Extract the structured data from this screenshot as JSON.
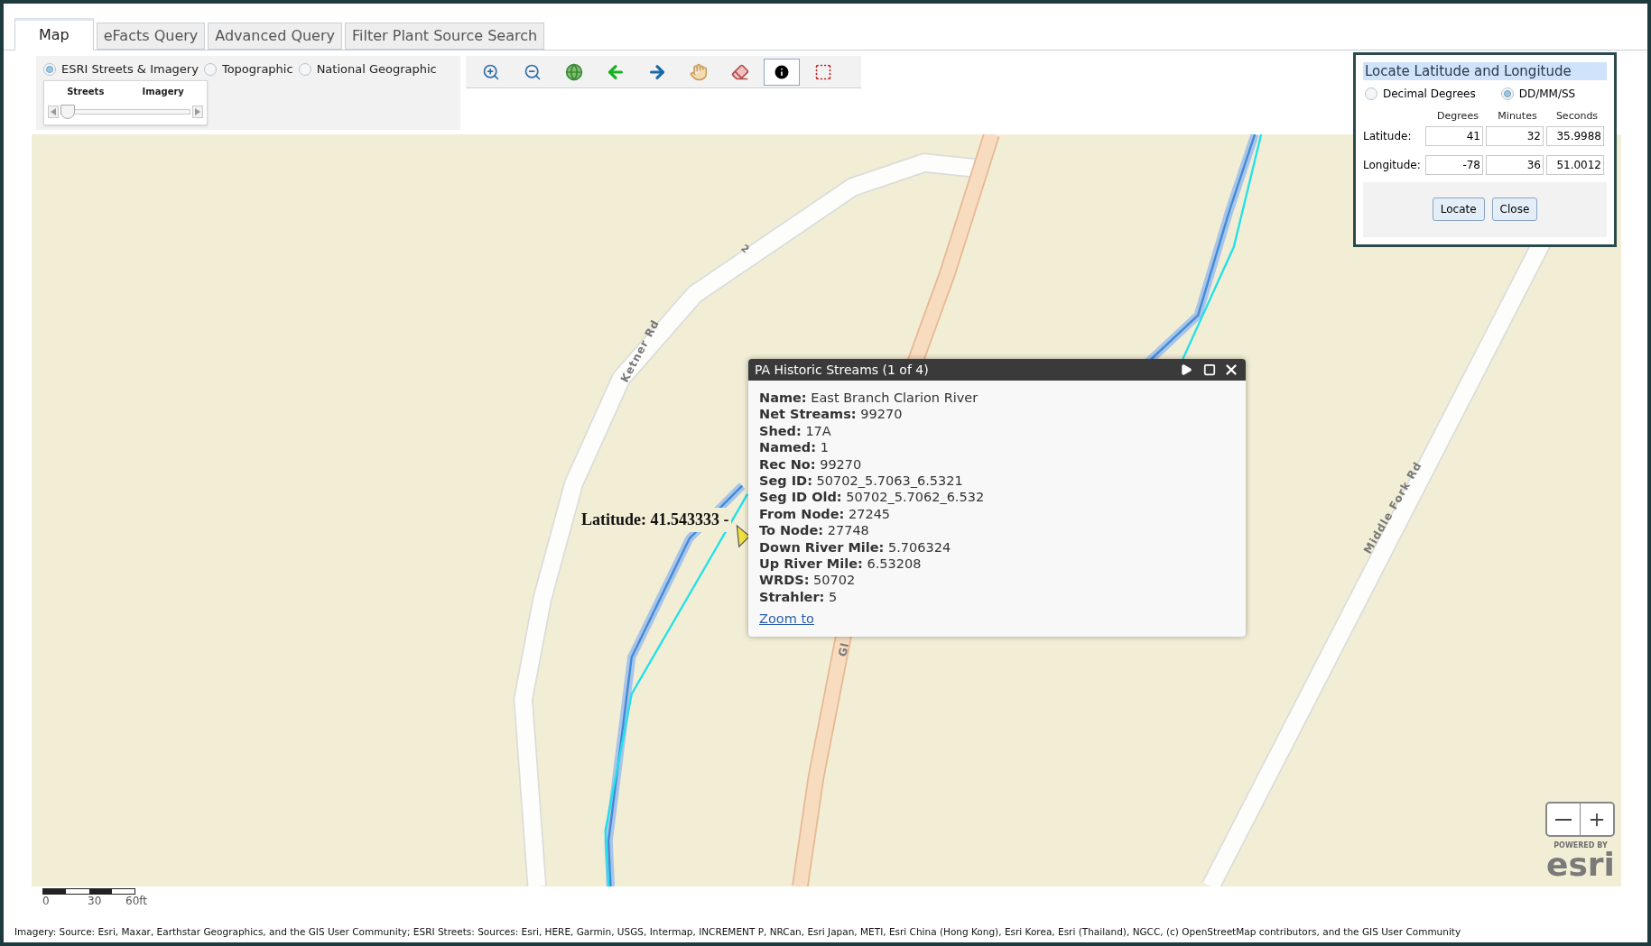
{
  "tabs": [
    {
      "label": "Map",
      "selected": true
    },
    {
      "label": "eFacts Query",
      "selected": false
    },
    {
      "label": "Advanced Query",
      "selected": false
    },
    {
      "label": "Filter Plant Source Search",
      "selected": false
    }
  ],
  "basemaps": [
    {
      "label": "ESRI Streets & Imagery",
      "selected": true
    },
    {
      "label": "Topographic",
      "selected": false
    },
    {
      "label": "National Geographic",
      "selected": false
    }
  ],
  "blend_slider": {
    "left_label": "Streets",
    "right_label": "Imagery",
    "level": 0.05
  },
  "tools": [
    {
      "kind": "zoom-in",
      "selected": false
    },
    {
      "kind": "zoom-out",
      "selected": false
    },
    {
      "kind": "globe",
      "selected": false
    },
    {
      "kind": "back",
      "selected": false
    },
    {
      "kind": "forward",
      "selected": false
    },
    {
      "kind": "pan",
      "selected": false
    },
    {
      "kind": "erase",
      "selected": false
    },
    {
      "kind": "info",
      "selected": true
    },
    {
      "kind": "select",
      "selected": false
    }
  ],
  "map": {
    "road_labels": [
      "Ketner Rd",
      "Middle Fork Rd",
      "2",
      "Gl"
    ],
    "coordinate_label": "Latitude: 41.543333 -"
  },
  "popup": {
    "title": "PA Historic Streams (1 of 4)",
    "fields": [
      {
        "label": "Name:",
        "value": "East Branch Clarion River"
      },
      {
        "label": "Net Streams:",
        "value": "99270"
      },
      {
        "label": "Shed:",
        "value": "17A"
      },
      {
        "label": "Named:",
        "value": "1"
      },
      {
        "label": "Rec No:",
        "value": "99270"
      },
      {
        "label": "Seg ID:",
        "value": "50702_5.7063_6.5321"
      },
      {
        "label": "Seg ID Old:",
        "value": "50702_5.7062_6.532"
      },
      {
        "label": "From Node:",
        "value": "27245"
      },
      {
        "label": "To Node:",
        "value": "27748"
      },
      {
        "label": "Down River Mile:",
        "value": "5.706324"
      },
      {
        "label": "Up River Mile:",
        "value": "6.53208"
      },
      {
        "label": "WRDS:",
        "value": "50702"
      },
      {
        "label": "Strahler:",
        "value": "5"
      }
    ],
    "link": "Zoom to"
  },
  "locate": {
    "title": "Locate Latitude and Longitude",
    "formats": [
      {
        "label": "Decimal Degrees",
        "selected": false
      },
      {
        "label": "DD/MM/SS",
        "selected": true
      }
    ],
    "column_headers": [
      "Degrees",
      "Minutes",
      "Seconds"
    ],
    "rows": [
      {
        "label": "Latitude:",
        "values": [
          "41",
          "32",
          "35.9988"
        ]
      },
      {
        "label": "Longitude:",
        "values": [
          "-78",
          "36",
          "51.0012"
        ]
      }
    ],
    "buttons": [
      "Locate",
      "Close"
    ]
  },
  "scale_bar": [
    "0",
    "30",
    "60ft"
  ],
  "logo": {
    "caption": "POWERED BY",
    "wordmark": "esri"
  },
  "attribution": "Imagery: Source: Esri, Maxar, Earthstar Geographics, and the GIS User Community; ESRI Streets: Sources: Esri, HERE, Garmin, USGS, Intermap, INCREMENT P, NRCan, Esri Japan, METI, Esri China (Hong Kong), Esri Korea, Esri (Thailand), NGCC, (c) OpenStreetMap contributors, and the GIS User Community"
}
